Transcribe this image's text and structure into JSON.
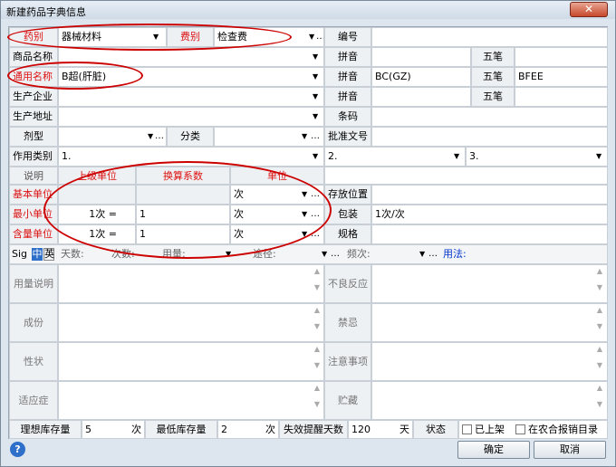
{
  "window": {
    "title": "新建药品字典信息",
    "close": "✕"
  },
  "row1": {
    "category_label": "药别",
    "category_value": "器械材料",
    "fee_label": "费别",
    "fee_value": "检查费",
    "code_label": "编号"
  },
  "row2": {
    "name_label": "商品名称",
    "pinyin_label": "拼音",
    "wubi_label": "五笔"
  },
  "row3": {
    "generic_label": "通用名称",
    "generic_value": "B超(肝脏)",
    "pinyin_label": "拼音",
    "pinyin_value": "BC(GZ)",
    "wubi_label": "五笔",
    "wubi_value": "BFEE"
  },
  "row4": {
    "maker_label": "生产企业",
    "pinyin_label": "拼音",
    "wubi_label": "五笔"
  },
  "row5": {
    "addr_label": "生产地址",
    "barcode_label": "条码"
  },
  "row6": {
    "form_label": "剂型",
    "class_label": "分类",
    "approval_label": "批准文号"
  },
  "row7": {
    "use_label": "作用类别",
    "use1": "1.",
    "use2": "2.",
    "use3": "3."
  },
  "units": {
    "h_desc": "说明",
    "h_upper": "上级单位",
    "h_factor": "换算系数",
    "h_unit": "单位",
    "r1_label": "基本单位",
    "r1_unit": "次",
    "r2_label": "最小单位",
    "r2_upper": "1次 =",
    "r2_factor": "1",
    "r2_unit": "次",
    "r3_label": "含量单位",
    "r3_upper": "1次 =",
    "r3_factor": "1",
    "r3_unit": "次",
    "storage_label": "存放位置",
    "pack_label": "包装",
    "pack_value": "1次/次",
    "spec_label": "规格"
  },
  "sig": {
    "sig_label": "Sig",
    "zh": "中",
    "en": "英",
    "days": "天数:",
    "times": "次数:",
    "dose": "用量:",
    "route": "途径:",
    "freq": "频次:",
    "usage": "用法:"
  },
  "text_areas": {
    "dosage": "用量说明",
    "adverse": "不良反应",
    "ingredients": "成份",
    "contra": "禁忌",
    "properties": "性状",
    "notes": "注意事项",
    "indications": "适应症",
    "storage": "贮藏"
  },
  "stock": {
    "ideal_label": "理想库存量",
    "ideal_value": "5",
    "ideal_unit": "次",
    "min_label": "最低库存量",
    "min_value": "2",
    "min_unit": "次",
    "expiry_label": "失效提醒天数",
    "expiry_value": "120",
    "expiry_unit": "天",
    "status_label": "状态",
    "shelved": "已上架",
    "rural": "在农合报销目录"
  },
  "buttons": {
    "ok": "确定",
    "cancel": "取消",
    "help": "?"
  }
}
